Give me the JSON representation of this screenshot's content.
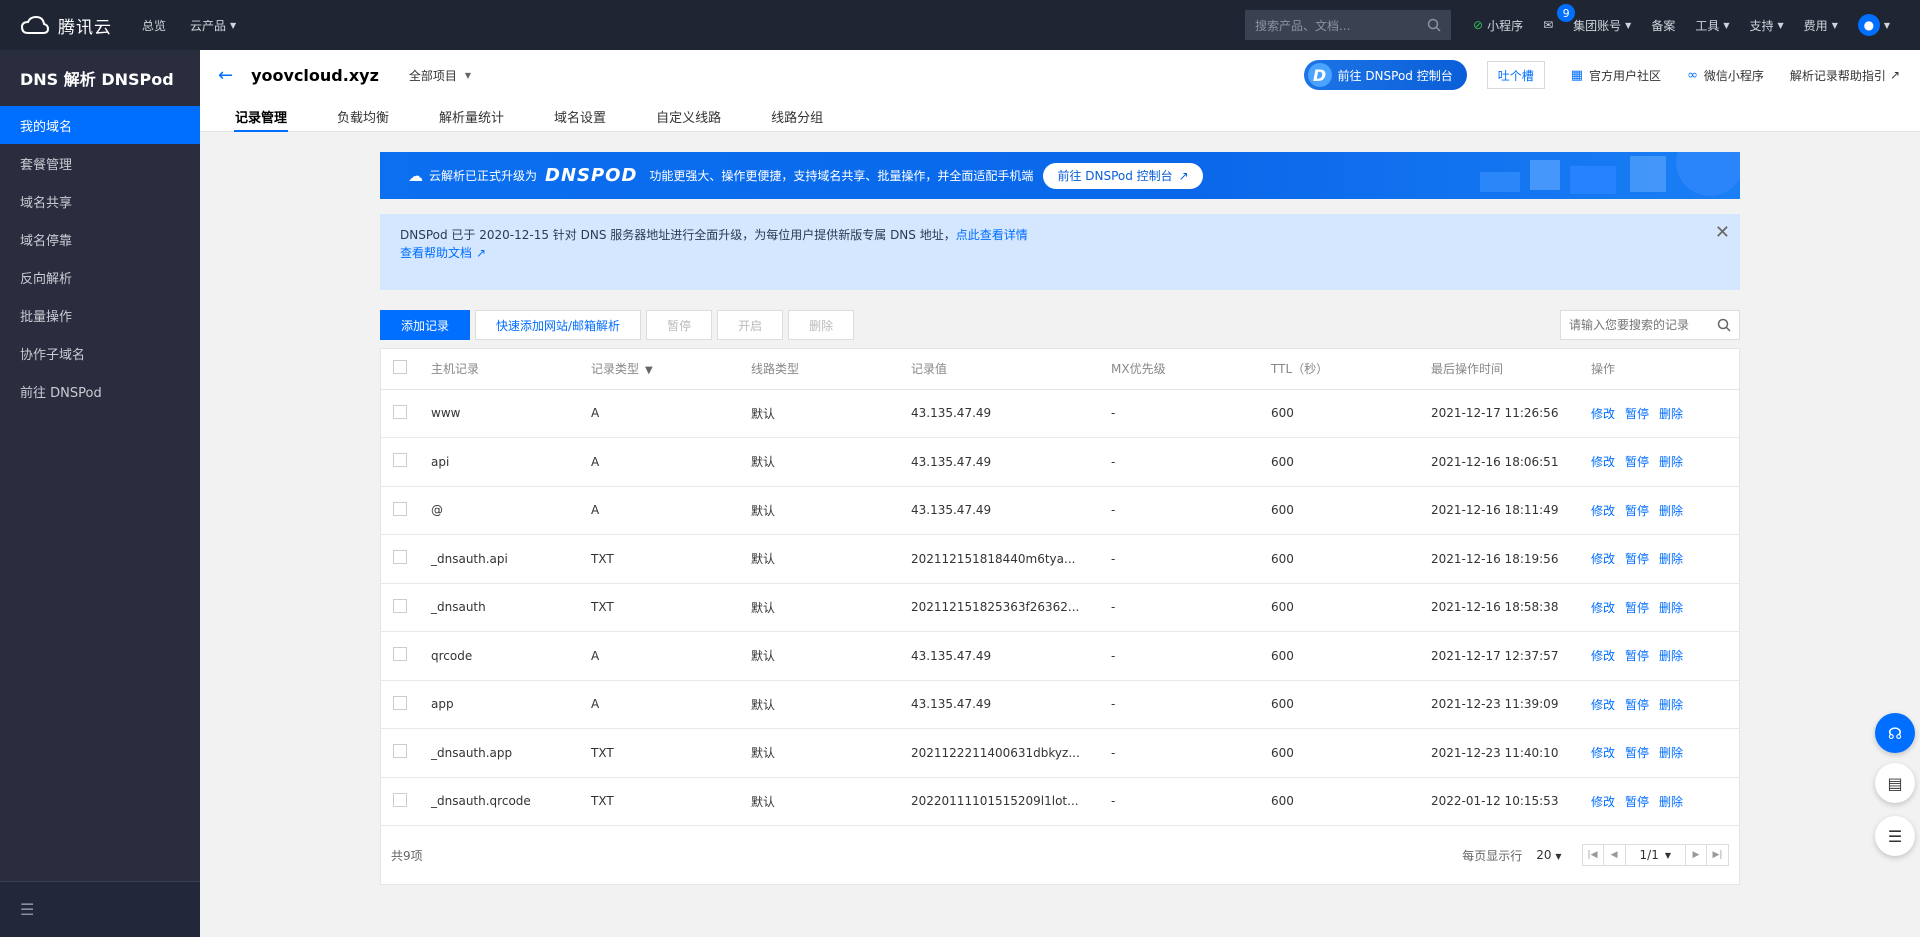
{
  "topnav": {
    "brand": "腾讯云",
    "links": [
      "总览",
      "云产品"
    ],
    "search_placeholder": "搜索产品、文档...",
    "miniapp": "小程序",
    "mail_badge": "9",
    "group_account": "集团账号",
    "beian": "备案",
    "tools": "工具",
    "support": "支持",
    "billing": "费用"
  },
  "sidebar": {
    "title": "DNS 解析 DNSPod",
    "items": [
      "我的域名",
      "套餐管理",
      "域名共享",
      "域名停靠",
      "反向解析",
      "批量操作",
      "协作子域名",
      "前往 DNSPod"
    ]
  },
  "header": {
    "domain": "yoovcloud.xyz",
    "project": "全部项目",
    "dnspod_btn": "前往 DNSPod 控制台",
    "feedback": "吐个槽",
    "community": "官方用户社区",
    "wechat": "微信小程序",
    "help": "解析记录帮助指引",
    "tabs": [
      "记录管理",
      "负载均衡",
      "解析量统计",
      "域名设置",
      "自定义线路",
      "线路分组"
    ]
  },
  "banner": {
    "text1": "云解析已正式升级为",
    "brand": "DNSPOD",
    "text2": "功能更强大、操作更便捷，支持域名共享、批量操作，并全面适配手机端",
    "button": "前往 DNSPod 控制台"
  },
  "notice": {
    "line1": "DNSPod 已于 2020-12-15 针对 DNS 服务器地址进行全面升级，为每位用户提供新版专属 DNS 地址，",
    "line1_link": "点此查看详情",
    "line2_link": "查看帮助文档"
  },
  "toolbar": {
    "add": "添加记录",
    "quick_add": "快速添加网站/邮箱解析",
    "pause": "暂停",
    "enable": "开启",
    "delete": "删除",
    "search_placeholder": "请输入您要搜索的记录"
  },
  "table": {
    "headers": [
      "主机记录",
      "记录类型",
      "线路类型",
      "记录值",
      "MX优先级",
      "TTL（秒）",
      "最后操作时间",
      "操作"
    ],
    "ops": [
      "修改",
      "暂停",
      "删除"
    ],
    "rows": [
      {
        "host": "www",
        "type": "A",
        "line": "默认",
        "value": "43.135.47.49",
        "mx": "-",
        "ttl": "600",
        "time": "2021-12-17 11:26:56"
      },
      {
        "host": "api",
        "type": "A",
        "line": "默认",
        "value": "43.135.47.49",
        "mx": "-",
        "ttl": "600",
        "time": "2021-12-16 18:06:51"
      },
      {
        "host": "@",
        "type": "A",
        "line": "默认",
        "value": "43.135.47.49",
        "mx": "-",
        "ttl": "600",
        "time": "2021-12-16 18:11:49"
      },
      {
        "host": "_dnsauth.api",
        "type": "TXT",
        "line": "默认",
        "value": "202112151818440m6tya...",
        "mx": "-",
        "ttl": "600",
        "time": "2021-12-16 18:19:56"
      },
      {
        "host": "_dnsauth",
        "type": "TXT",
        "line": "默认",
        "value": "202112151825363f26362...",
        "mx": "-",
        "ttl": "600",
        "time": "2021-12-16 18:58:38"
      },
      {
        "host": "qrcode",
        "type": "A",
        "line": "默认",
        "value": "43.135.47.49",
        "mx": "-",
        "ttl": "600",
        "time": "2021-12-17 12:37:57"
      },
      {
        "host": "app",
        "type": "A",
        "line": "默认",
        "value": "43.135.47.49",
        "mx": "-",
        "ttl": "600",
        "time": "2021-12-23 11:39:09"
      },
      {
        "host": "_dnsauth.app",
        "type": "TXT",
        "line": "默认",
        "value": "202112221140063​1dbkyz...",
        "mx": "-",
        "ttl": "600",
        "time": "2021-12-23 11:40:10"
      },
      {
        "host": "_dnsauth.qrcode",
        "type": "TXT",
        "line": "默认",
        "value": "20220111101515209l1lot...",
        "mx": "-",
        "ttl": "600",
        "time": "2022-01-12 10:15:53"
      }
    ],
    "total": "共9项",
    "per_page_label": "每页显示行",
    "per_page": "20",
    "page_info": "1/1"
  }
}
